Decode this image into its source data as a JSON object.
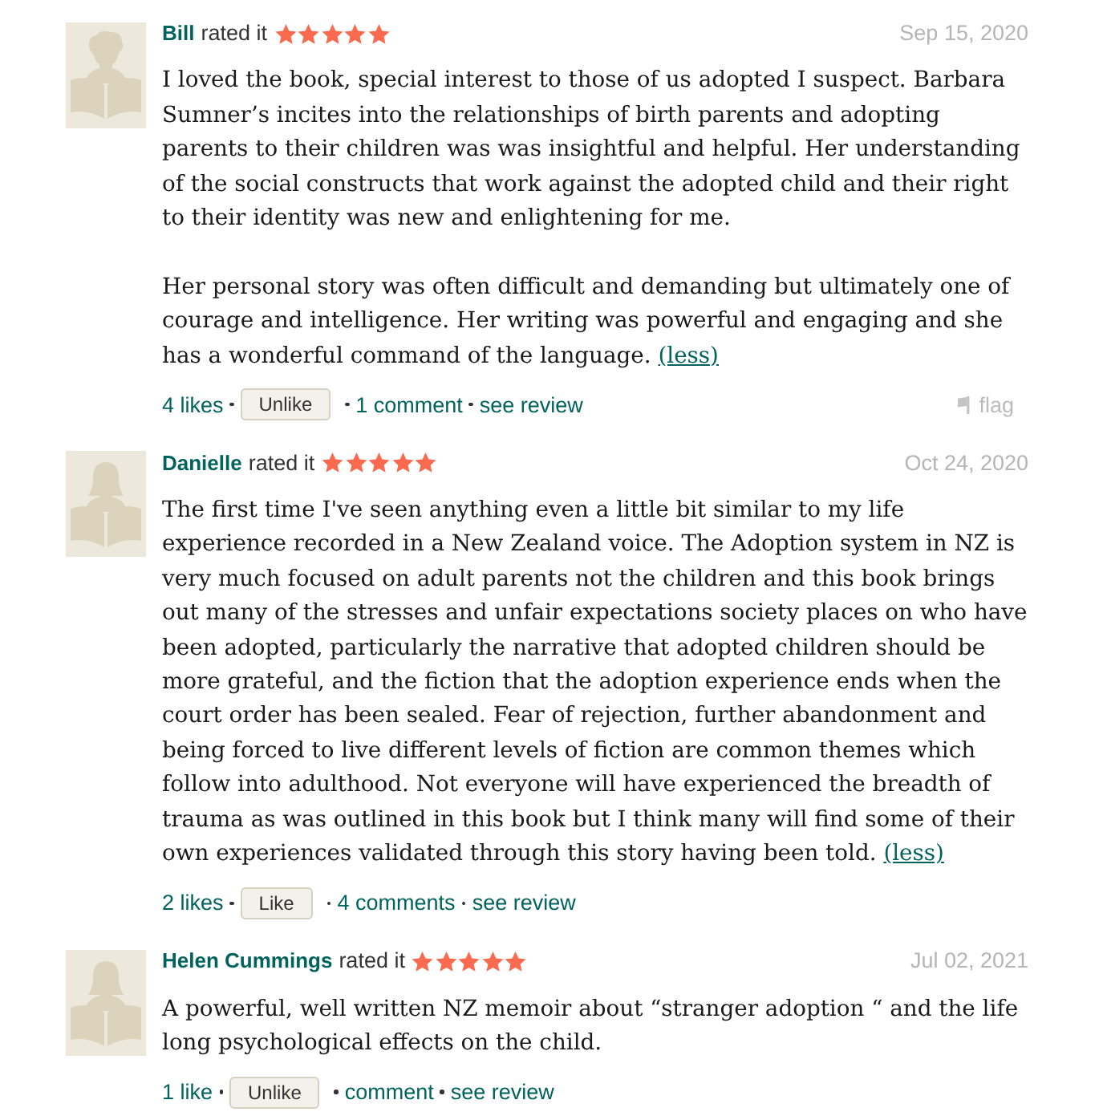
{
  "reviews": [
    {
      "avatar": {
        "kind": "man"
      },
      "reviewer": "Bill",
      "action": "rated it",
      "stars": 5,
      "date": "Sep 15, 2020",
      "paragraphs": [
        "I loved the book, special interest to those of us adopted I suspect. Barbara Sumner’s incites into the relationships of birth parents and adopting parents to their children was was insightful and helpful. Her understanding of the social constructs that work against the adopted child and their right to their identity was new and enlightening for me.",
        "Her personal story was often difficult and demanding but ultimately one of courage and intelligence. Her writing was powerful and engaging and she has a wonderful command of the language."
      ],
      "less_link": "(less)",
      "likes": "4 likes",
      "like_button": "Unlike",
      "comments": "1 comment",
      "see_review": "see review",
      "flag": "flag"
    },
    {
      "avatar": {
        "kind": "woman"
      },
      "reviewer": "Danielle",
      "action": "rated it",
      "stars": 5,
      "date": "Oct 24, 2020",
      "paragraphs": [
        "The first time I've seen anything even a little bit similar to my life experience recorded in a New Zealand voice. The Adoption system in NZ is very much focused on adult parents not the children and this book brings out many of the stresses and unfair expectations society places on who have been adopted, particularly the narrative that adopted children should be more grateful, and the fiction that the adoption experience ends when the court order has been sealed. Fear of rejection, further abandonment and being forced to live different levels of fiction are common themes which follow into adulthood. Not everyone will have experienced the breadth of trauma as was outlined in this book but I think many will find some of their own experiences validated through this story having been told."
      ],
      "less_link": "(less)",
      "likes": "2 likes",
      "like_button": "Like",
      "comments": "4 comments",
      "see_review": "see review"
    },
    {
      "avatar": {
        "kind": "woman"
      },
      "reviewer": "Helen Cummings",
      "action": "rated it",
      "stars": 5,
      "date": "Jul 02, 2021",
      "paragraphs": [
        "A powerful, well written NZ memoir about “stranger adoption “ and the life long psychological effects on the child."
      ],
      "likes": "1 like",
      "like_button": "Unlike",
      "comments": "comment",
      "see_review": "see review"
    }
  ]
}
